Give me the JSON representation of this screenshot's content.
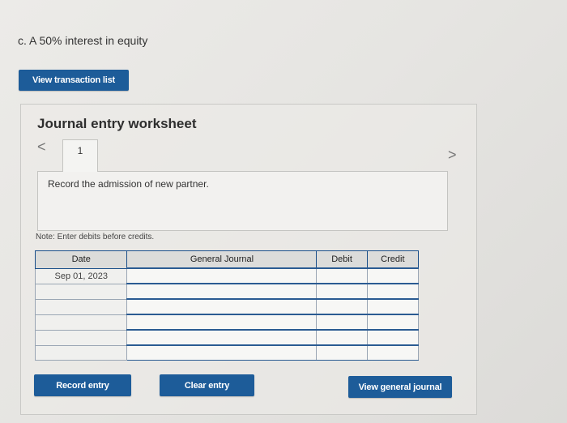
{
  "question": {
    "label": "c. A 50% interest in equity"
  },
  "buttons": {
    "view_transaction_list": "View transaction list",
    "record_entry": "Record entry",
    "clear_entry": "Clear entry",
    "view_general_journal": "View general journal"
  },
  "worksheet": {
    "title": "Journal entry worksheet",
    "prev_icon": "<",
    "next_icon": ">",
    "tab_label": "1",
    "instruction": "Record the admission of new partner.",
    "note": "Note: Enter debits before credits."
  },
  "journal": {
    "headers": {
      "date": "Date",
      "general_journal": "General Journal",
      "debit": "Debit",
      "credit": "Credit"
    },
    "rows": [
      {
        "date": "Sep 01, 2023",
        "account": "",
        "debit": "",
        "credit": ""
      },
      {
        "date": "",
        "account": "",
        "debit": "",
        "credit": ""
      },
      {
        "date": "",
        "account": "",
        "debit": "",
        "credit": ""
      },
      {
        "date": "",
        "account": "",
        "debit": "",
        "credit": ""
      },
      {
        "date": "",
        "account": "",
        "debit": "",
        "credit": ""
      },
      {
        "date": "",
        "account": "",
        "debit": "",
        "credit": ""
      }
    ]
  },
  "colors": {
    "button_bg": "#1d5c99",
    "table_border": "#1a4f8a"
  }
}
